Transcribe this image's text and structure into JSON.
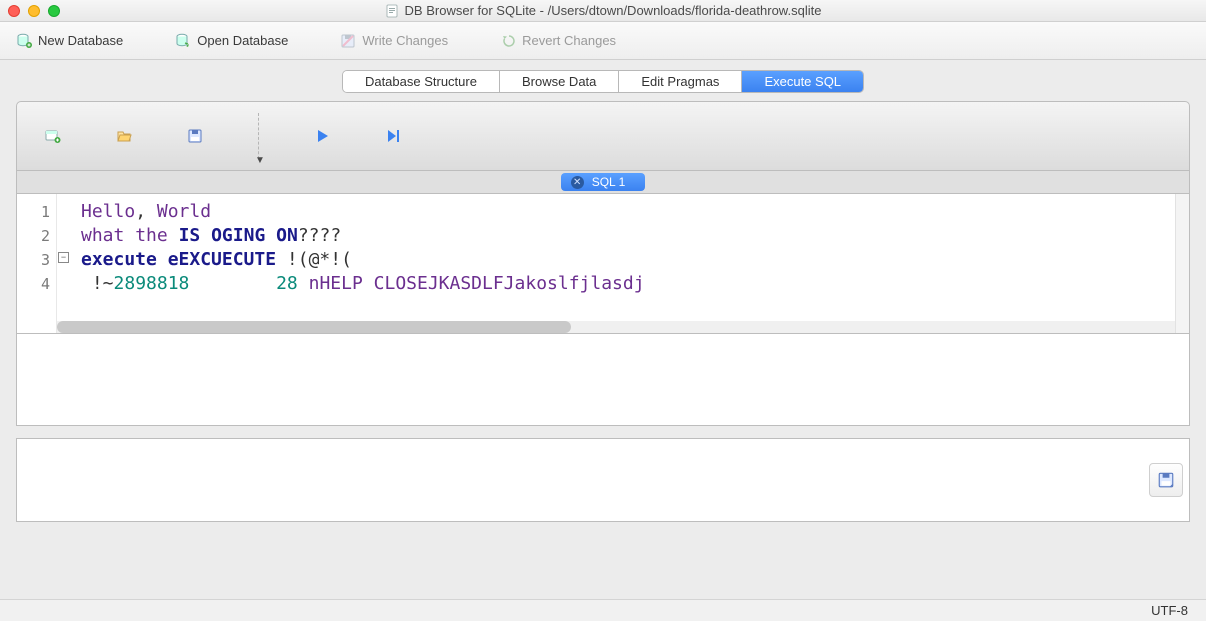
{
  "window": {
    "title": "DB Browser for SQLite - /Users/dtown/Downloads/florida-deathrow.sqlite"
  },
  "main_toolbar": {
    "new_db": "New Database",
    "open_db": "Open Database",
    "write_changes": "Write Changes",
    "revert_changes": "Revert Changes"
  },
  "tabs": {
    "structure": "Database Structure",
    "browse": "Browse Data",
    "pragmas": "Edit Pragmas",
    "execute": "Execute SQL"
  },
  "sql_tab": {
    "label": "SQL 1"
  },
  "editor": {
    "line_numbers": [
      "1",
      "2",
      "3",
      "4"
    ],
    "lines": [
      [
        {
          "t": "Hello",
          "c": "tok-wd"
        },
        {
          "t": ", ",
          "c": "tok-op"
        },
        {
          "t": "World",
          "c": "tok-wd"
        }
      ],
      [
        {
          "t": "what",
          "c": "tok-wd"
        },
        {
          "t": " ",
          "c": "tok-op"
        },
        {
          "t": "the",
          "c": "tok-wd"
        },
        {
          "t": " ",
          "c": "tok-op"
        },
        {
          "t": "IS",
          "c": "tok-kw"
        },
        {
          "t": " ",
          "c": "tok-op"
        },
        {
          "t": "OGING",
          "c": "tok-kw"
        },
        {
          "t": " ",
          "c": "tok-op"
        },
        {
          "t": "ON",
          "c": "tok-kw"
        },
        {
          "t": "????",
          "c": "tok-op"
        }
      ],
      [
        {
          "t": "execute",
          "c": "tok-kw"
        },
        {
          "t": " ",
          "c": "tok-op"
        },
        {
          "t": "eEXCUECUTE",
          "c": "tok-kw"
        },
        {
          "t": " !(@*!(",
          "c": "tok-op"
        }
      ],
      [
        {
          "t": " !~",
          "c": "tok-op"
        },
        {
          "t": "2898818",
          "c": "tok-num"
        },
        {
          "t": "        ",
          "c": "tok-op"
        },
        {
          "t": "28",
          "c": "tok-num"
        },
        {
          "t": " ",
          "c": "tok-op"
        },
        {
          "t": "nHELP",
          "c": "tok-wd"
        },
        {
          "t": " ",
          "c": "tok-op"
        },
        {
          "t": "CLOSEJKASDLFJakoslfjlasdj",
          "c": "tok-wd"
        }
      ]
    ]
  },
  "status": {
    "encoding": "UTF-8"
  }
}
